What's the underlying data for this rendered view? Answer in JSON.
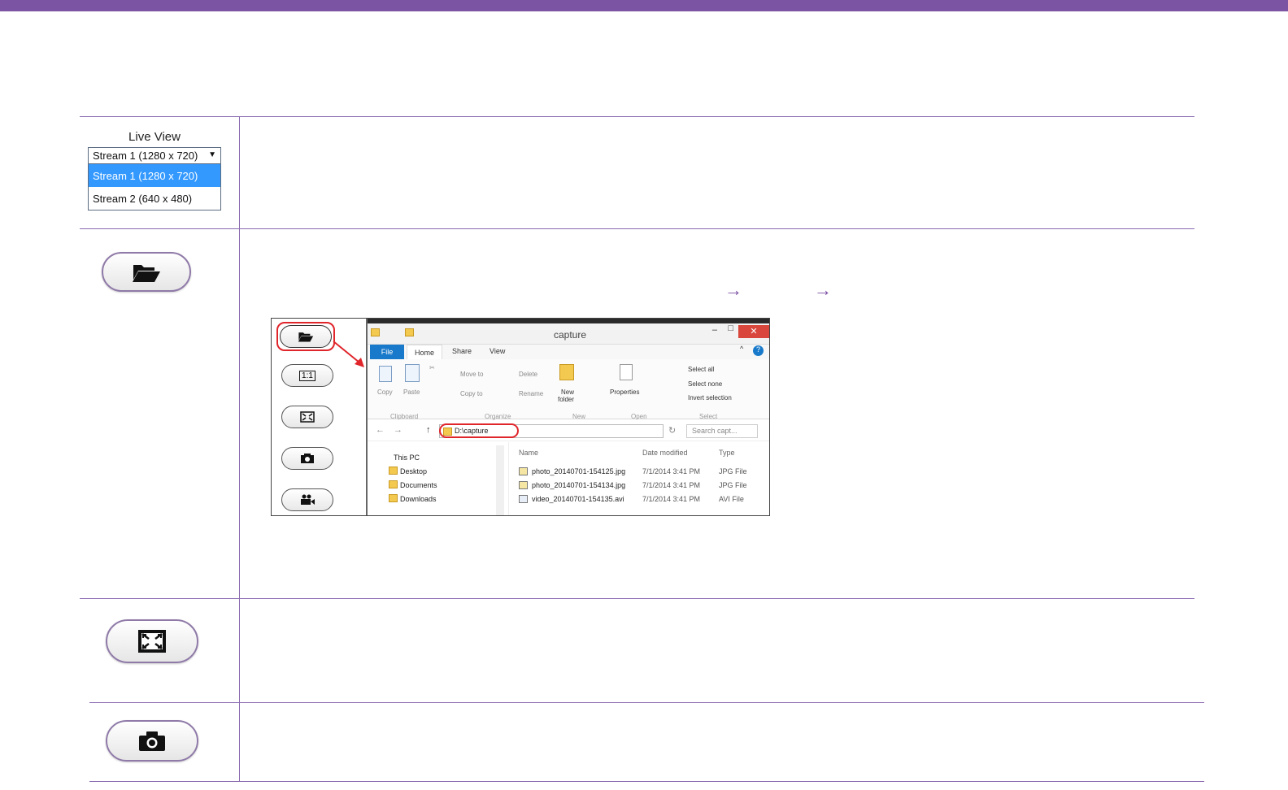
{
  "live_view": {
    "title": "Live View",
    "selected": "Stream 1 (1280 x 720)",
    "options": [
      "Stream 1 (1280 x 720)",
      "Stream 2 (640 x 480)"
    ]
  },
  "buttons": {
    "open_folder": "folder-open-icon",
    "fullscreen": "fullscreen-icon",
    "snapshot": "camera-icon"
  },
  "explorer": {
    "window_title": "capture",
    "tabs": [
      "File",
      "Home",
      "Share",
      "View"
    ],
    "ribbon": {
      "copy": "Copy",
      "paste": "Paste",
      "move_to": "Move to",
      "copy_to": "Copy to",
      "delete": "Delete",
      "rename": "Rename",
      "new_folder_1": "New",
      "new_folder_2": "folder",
      "properties": "Properties",
      "select_all": "Select all",
      "select_none": "Select none",
      "invert_selection": "Invert selection",
      "groups": [
        "Clipboard",
        "Organize",
        "New",
        "Open",
        "Select"
      ]
    },
    "address": "D:\\capture",
    "search_placeholder": "Search capt...",
    "nav": [
      "This PC",
      "Desktop",
      "Documents",
      "Downloads"
    ],
    "columns": [
      "Name",
      "Date modified",
      "Type"
    ],
    "files": [
      {
        "name": "photo_20140701-154125.jpg",
        "date": "7/1/2014 3:41 PM",
        "type": "JPG File"
      },
      {
        "name": "photo_20140701-154134.jpg",
        "date": "7/1/2014 3:41 PM",
        "type": "JPG File"
      },
      {
        "name": "video_20140701-154135.avi",
        "date": "7/1/2014 3:41 PM",
        "type": "AVI File"
      }
    ],
    "side_buttons": [
      "1:1"
    ]
  }
}
